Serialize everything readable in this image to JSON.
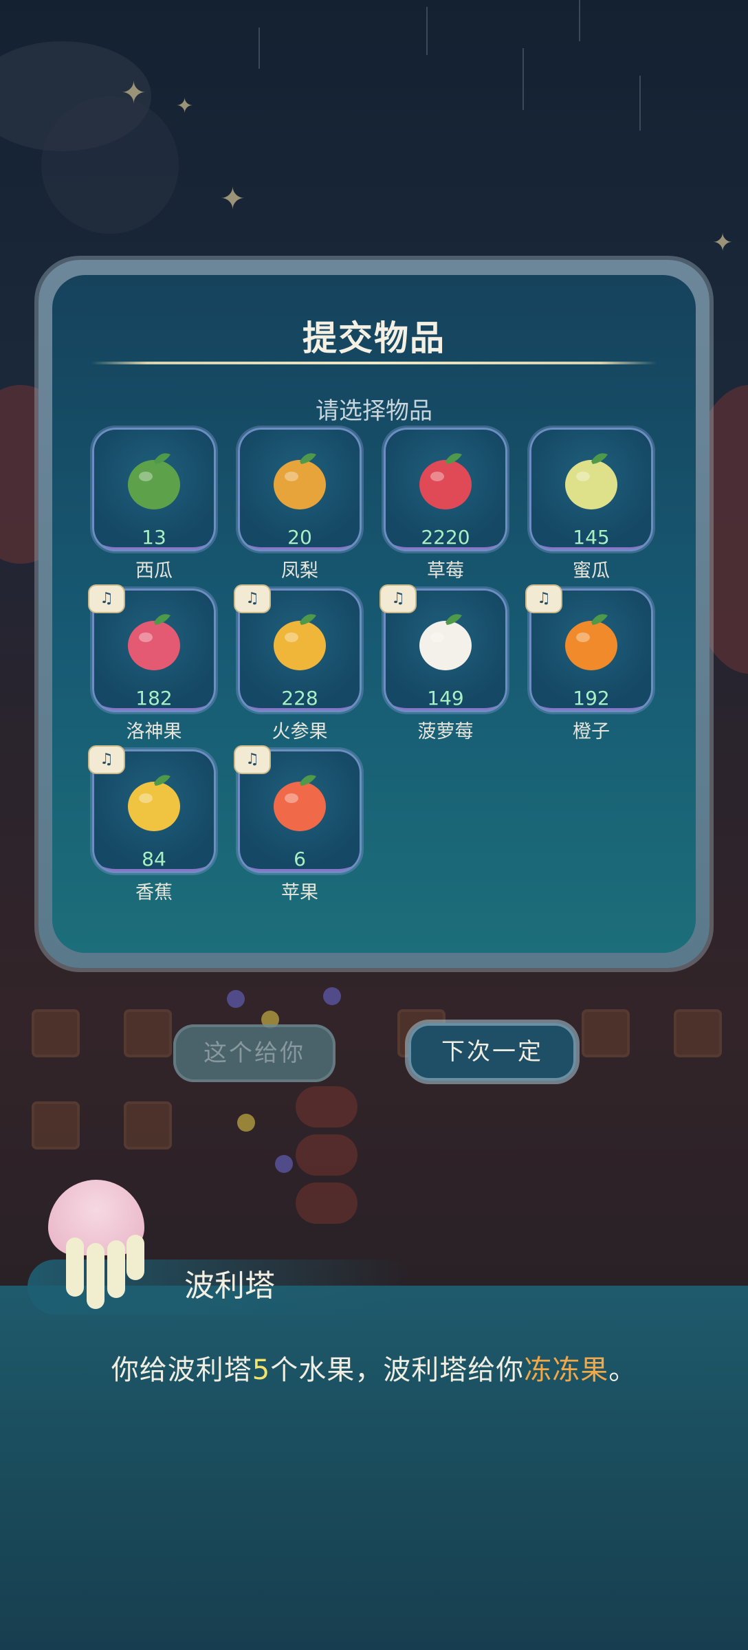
{
  "dialog_title": "提交物品",
  "subtitle": "请选择物品",
  "badge_icon": "utensils-icon",
  "items": [
    {
      "name": "西瓜",
      "count": "13",
      "badge": false,
      "color": "#5da24b",
      "icon": "watermelon-icon"
    },
    {
      "name": "凤梨",
      "count": "20",
      "badge": false,
      "color": "#e7a43a",
      "icon": "pineapple-icon"
    },
    {
      "name": "草莓",
      "count": "2220",
      "badge": false,
      "color": "#e04a56",
      "icon": "strawberry-icon"
    },
    {
      "name": "蜜瓜",
      "count": "145",
      "badge": false,
      "color": "#dfe08a",
      "icon": "melon-icon"
    },
    {
      "name": "洛神果",
      "count": "182",
      "badge": true,
      "color": "#e55a73",
      "icon": "roselle-icon"
    },
    {
      "name": "火参果",
      "count": "228",
      "badge": true,
      "color": "#f0b63a",
      "icon": "horned-melon-icon"
    },
    {
      "name": "菠萝莓",
      "count": "149",
      "badge": true,
      "color": "#f4f0ea",
      "icon": "pineberry-icon"
    },
    {
      "name": "橙子",
      "count": "192",
      "badge": true,
      "color": "#f08a2a",
      "icon": "orange-icon"
    },
    {
      "name": "香蕉",
      "count": "84",
      "badge": true,
      "color": "#f0c340",
      "icon": "banana-icon"
    },
    {
      "name": "苹果",
      "count": "6",
      "badge": true,
      "color": "#f06a4a",
      "icon": "apple-icon"
    }
  ],
  "buttons": {
    "give": "这个给你",
    "next": "下次一定"
  },
  "speaker": "波利塔",
  "dialogue": {
    "part1": "你给波利塔",
    "num": "5",
    "part2": "个水果，波利塔给你",
    "item": "冻冻果",
    "end": "。"
  }
}
